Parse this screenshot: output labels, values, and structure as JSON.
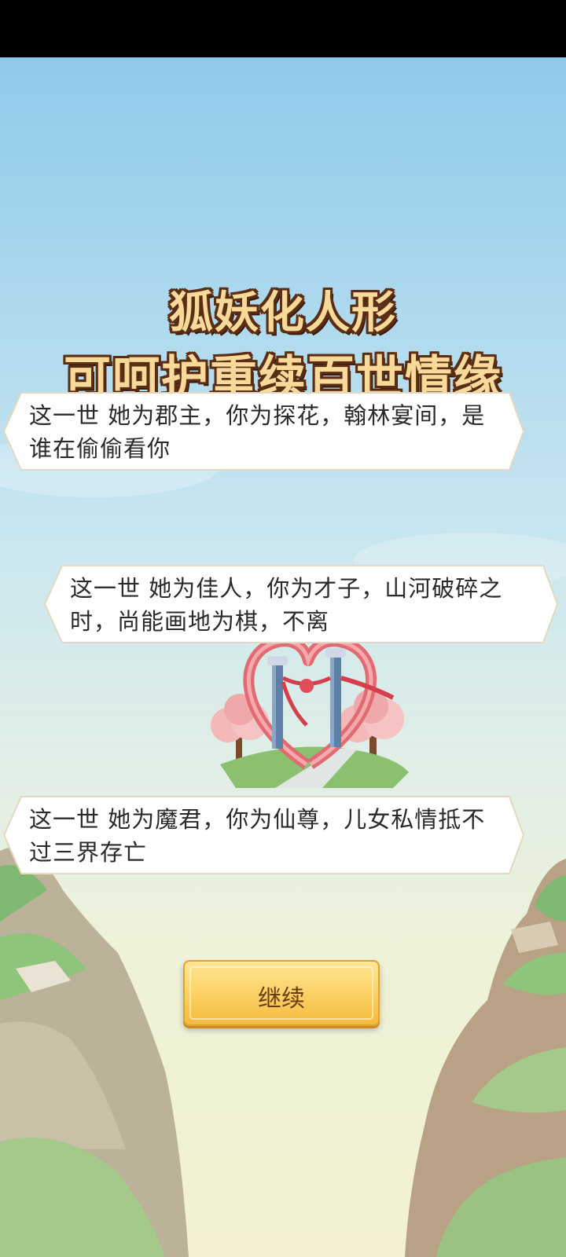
{
  "title": {
    "line1": "狐妖化人形",
    "line2": "可呵护重续百世情缘"
  },
  "bubbles": [
    {
      "text": "这一世 她为郡主，你为探花，翰林宴间，是谁在偷偷看你"
    },
    {
      "text": "这一世 她为佳人，你为才子，山河破碎之时，尚能画地为棋，不离"
    },
    {
      "text": "这一世 她为魔君，你为仙尊，儿女私情抵不过三界存亡"
    }
  ],
  "button": {
    "continue_label": "继续"
  },
  "colors": {
    "title_fill": "#f7d99a",
    "title_outline": "#5a2d14",
    "button": "#f9cc5c",
    "sky": "#8fc9ea"
  },
  "icons": [
    "heart-gate-illustration",
    "mountain-left",
    "mountain-right"
  ]
}
